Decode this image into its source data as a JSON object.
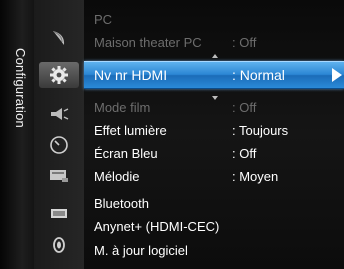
{
  "sidebar": {
    "title": "Configuration"
  },
  "icons": [
    {
      "name": "satellite-icon"
    },
    {
      "name": "gear-icon"
    },
    {
      "name": "sound-icon"
    },
    {
      "name": "timer-icon"
    },
    {
      "name": "channel-icon"
    },
    {
      "name": "screen-icon"
    },
    {
      "name": "support-icon"
    }
  ],
  "menu": {
    "items": [
      {
        "label": "PC",
        "value": "",
        "state": "dim"
      },
      {
        "label": "Maison theater PC",
        "value": ": Off",
        "state": "dim"
      },
      {
        "label": "Nv nr HDMI",
        "value": ": Normal",
        "state": "selected"
      },
      {
        "label": "Mode film",
        "value": ": Off",
        "state": "dim"
      },
      {
        "label": "Effet lumière",
        "value": ": Toujours",
        "state": "normal"
      },
      {
        "label": "Écran Bleu",
        "value": ": Off",
        "state": "normal"
      },
      {
        "label": "Mélodie",
        "value": ": Moyen",
        "state": "normal"
      },
      {
        "label": "Bluetooth",
        "value": "",
        "state": "normal"
      },
      {
        "label": "Anynet+ (HDMI-CEC)",
        "value": "",
        "state": "normal"
      },
      {
        "label": "M. à jour logiciel",
        "value": "",
        "state": "normal"
      }
    ]
  },
  "colors": {
    "selection": "#2b86d4",
    "dim_text": "#6d6d6d",
    "text": "#ffffff"
  }
}
